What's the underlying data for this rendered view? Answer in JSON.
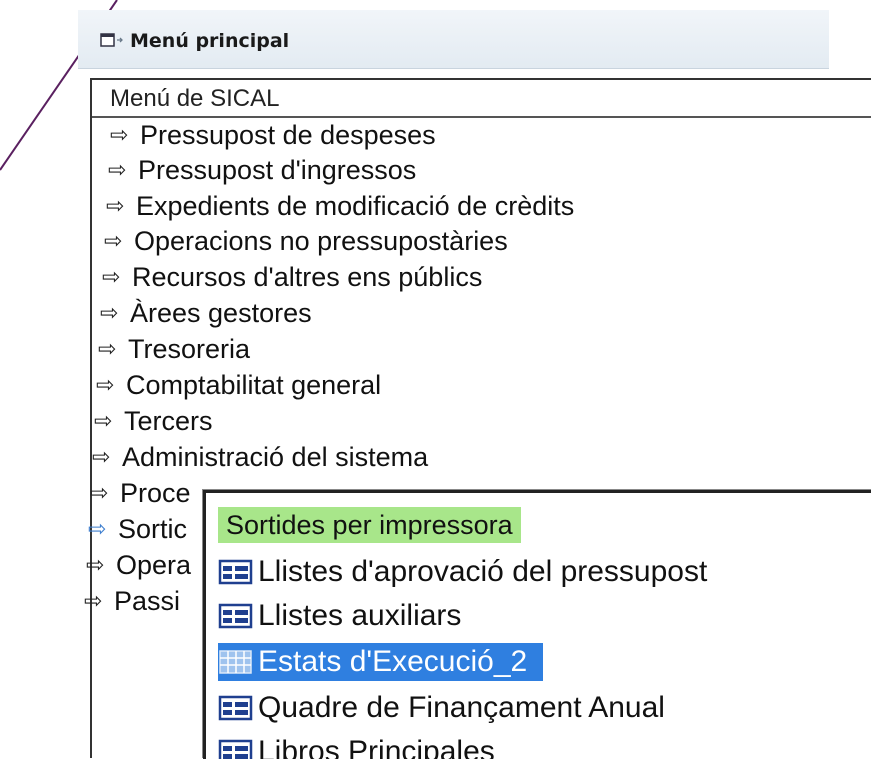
{
  "window": {
    "title": "Menú principal"
  },
  "menu": {
    "header": "Menú de SICAL",
    "items": [
      {
        "label": "Pressupost de despeses"
      },
      {
        "label": "Pressupost d'ingressos"
      },
      {
        "label": "Expedients de modificació de crèdits"
      },
      {
        "label": "Operacions no pressupostàries"
      },
      {
        "label": "Recursos d'altres ens públics"
      },
      {
        "label": "Àrees gestores"
      },
      {
        "label": "Tresoreria"
      },
      {
        "label": "Comptabilitat general"
      },
      {
        "label": "Tercers"
      },
      {
        "label": "Administració del sistema"
      },
      {
        "label": "Proce"
      },
      {
        "label": "Sortic",
        "active": true
      },
      {
        "label": "Opera"
      },
      {
        "label": "Passi"
      }
    ]
  },
  "submenu": {
    "title": "Sortides per impressora",
    "items": [
      {
        "label": "Llistes d'aprovació del pressupost"
      },
      {
        "label": "Llistes auxiliars"
      },
      {
        "label": "Estats d'Execució_2",
        "selected": true
      },
      {
        "label": "Quadre de Finançament Anual"
      },
      {
        "label": "Libros Principales"
      }
    ]
  },
  "colors": {
    "accent_square": "#a0219a",
    "submenu_title_bg": "#a8e68a",
    "selection_bg": "#2f7fe0",
    "diagonal_line": "#5a2060"
  }
}
